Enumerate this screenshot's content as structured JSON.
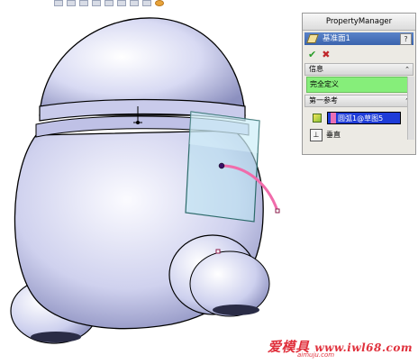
{
  "property_manager": {
    "header": "PropertyManager",
    "feature_title": "基准面1",
    "help": "?",
    "ok_glyph": "✔",
    "cancel_glyph": "✖",
    "message_group": {
      "label": "信息",
      "status": "完全定义"
    },
    "first_reference": {
      "label": "第一参考",
      "value": "圆弧1@草图5",
      "option": "垂直"
    },
    "collapse_glyph": "⌃"
  },
  "watermark": {
    "brand": "爱模具",
    "url": "www.iwl68.com",
    "sub": "aimuju.com"
  },
  "colors": {
    "model": "#d4d6f2",
    "plane": "#b8e4f0",
    "sketch_arc": "#f06cab",
    "selected_field": "#1e3cd8",
    "status_ok": "#86ee7a"
  }
}
